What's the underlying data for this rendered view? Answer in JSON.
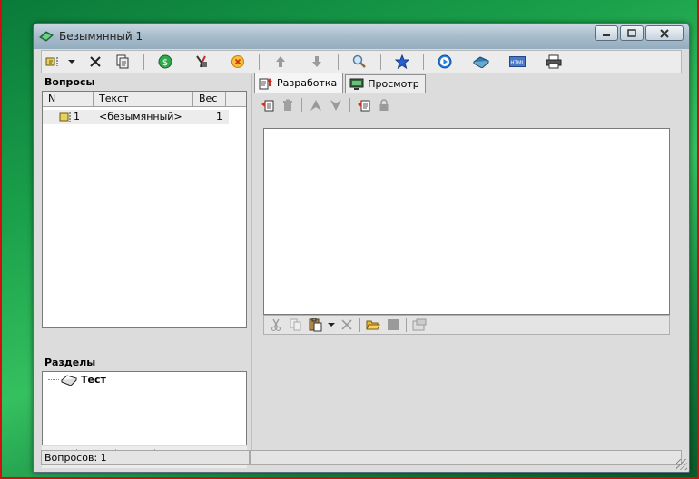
{
  "window": {
    "title": "Безымянный 1"
  },
  "colors": {
    "accent": "#2a7be0",
    "titlebar": "#a7bccb",
    "window_bg": "#dcdcdc"
  },
  "toolbar": {
    "buttons": [
      {
        "icon": "new-question-icon"
      },
      {
        "icon": "dropdown-arrow-icon"
      },
      {
        "icon": "delete-icon"
      },
      {
        "icon": "copy-question-icon"
      },
      {
        "icon": "money-icon"
      },
      {
        "icon": "tools-icon"
      },
      {
        "icon": "cancel-circle-icon"
      },
      {
        "icon": "arrow-up-icon"
      },
      {
        "icon": "arrow-down-icon"
      },
      {
        "icon": "search-icon"
      },
      {
        "icon": "star-icon"
      },
      {
        "icon": "play-icon"
      },
      {
        "icon": "book-icon"
      },
      {
        "icon": "html-icon"
      },
      {
        "icon": "printer-icon"
      }
    ]
  },
  "questions": {
    "header": "Вопросы",
    "columns": [
      "N",
      "Текст",
      "Вес"
    ],
    "rows": [
      {
        "n": "1",
        "text": "<безымянный>",
        "weight": "1"
      }
    ]
  },
  "sections": {
    "header": "Разделы",
    "items": [
      {
        "label": "Тест"
      }
    ]
  },
  "tabs": [
    {
      "label": "Разработка",
      "icon": "development-icon",
      "active": true
    },
    {
      "label": "Просмотр",
      "icon": "monitor-icon",
      "active": false
    }
  ],
  "status": {
    "questions_count": "Вопросов: 1"
  }
}
